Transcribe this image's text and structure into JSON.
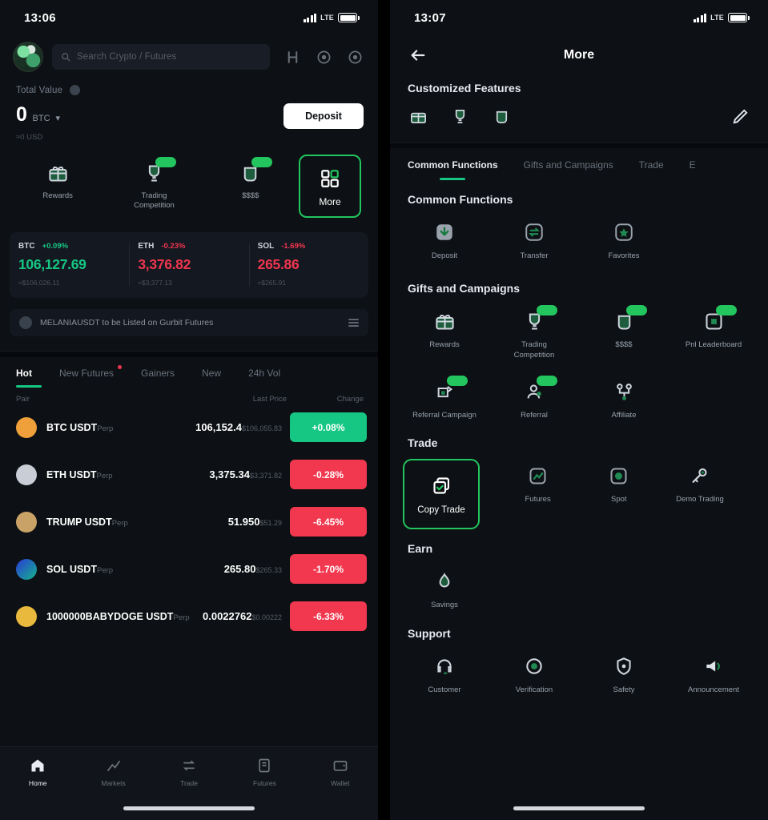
{
  "left": {
    "status": {
      "time": "13:06",
      "network": "LTE"
    },
    "header": {
      "search_placeholder": "Search Crypto / Futures",
      "icons": [
        "menu-icon",
        "support-icon",
        "notification-icon"
      ]
    },
    "balance": {
      "total_value_label": "Total Value",
      "amount": "0",
      "currency": "BTC",
      "approx": "≈0 USD",
      "deposit_label": "Deposit"
    },
    "quick_actions": [
      {
        "label": "Rewards",
        "icon": "gift-icon",
        "badge": false
      },
      {
        "label": "Trading Competition",
        "icon": "trophy-icon",
        "badge": true
      },
      {
        "label": "$$$$",
        "icon": "coin-icon",
        "badge": true
      },
      {
        "label": "More",
        "icon": "grid-icon",
        "badge": false,
        "selected": true
      }
    ],
    "tickers": [
      {
        "symbol": "BTC",
        "change": "+0.09%",
        "price": "106,127.69",
        "volume": "≈$106,026.11",
        "dir": "up"
      },
      {
        "symbol": "ETH",
        "change": "-0.23%",
        "price": "3,376.82",
        "volume": "≈$3,377.13",
        "dir": "down"
      },
      {
        "symbol": "SOL",
        "change": "-1.69%",
        "price": "265.86",
        "volume": "≈$265.91",
        "dir": "down"
      }
    ],
    "announcement": {
      "text": "MELANIAUSDT to be Listed on Gurbit Futures"
    },
    "market": {
      "tabs": [
        {
          "label": "Hot",
          "active": true,
          "dot": false
        },
        {
          "label": "New Futures",
          "active": false,
          "dot": true
        },
        {
          "label": "Gainers",
          "active": false,
          "dot": false
        },
        {
          "label": "New",
          "active": false,
          "dot": false
        },
        {
          "label": "24h Vol",
          "active": false,
          "dot": false
        }
      ],
      "columns": {
        "pair": "Pair",
        "last_price": "Last Price",
        "change": "Change"
      },
      "rows": [
        {
          "symbol": "BTC USDT",
          "type": "Perp",
          "price": "106,152.4",
          "volume": "$106,055.83",
          "change": "+0.08%",
          "dir": "up",
          "color": "#f0a03a"
        },
        {
          "symbol": "ETH USDT",
          "type": "Perp",
          "price": "3,375.34",
          "volume": "$3,371.82",
          "change": "-0.28%",
          "dir": "down",
          "color": "#c8cdd6"
        },
        {
          "symbol": "TRUMP USDT",
          "type": "Perp",
          "price": "51.950",
          "volume": "$51.29",
          "change": "-6.45%",
          "dir": "down",
          "color": "#c9a267"
        },
        {
          "symbol": "SOL USDT",
          "type": "Perp",
          "price": "265.80",
          "volume": "$265.33",
          "change": "-1.70%",
          "dir": "down",
          "color": "#3b5bd6"
        },
        {
          "symbol": "1000000BABYDOGE USDT",
          "type": "Perp",
          "price": "0.0022762",
          "volume": "$0.00222",
          "change": "-6.33%",
          "dir": "down",
          "color": "#e8b93c"
        }
      ]
    },
    "bottom_nav": [
      {
        "label": "Home",
        "icon": "home-icon",
        "active": true
      },
      {
        "label": "Markets",
        "icon": "chart-icon",
        "active": false
      },
      {
        "label": "Trade",
        "icon": "trade-icon",
        "active": false
      },
      {
        "label": "Futures",
        "icon": "futures-icon",
        "active": false
      },
      {
        "label": "Wallet",
        "icon": "wallet-icon",
        "active": false
      }
    ]
  },
  "right": {
    "status": {
      "time": "13:07",
      "network": "LTE"
    },
    "title": "More",
    "back_icon": "back-arrow-icon",
    "customized": {
      "title": "Customized Features",
      "edit_icon": "pencil-icon",
      "icons": [
        "gift-icon",
        "trophy-icon",
        "coin-icon"
      ]
    },
    "tabs": [
      {
        "label": "Common Functions",
        "active": true
      },
      {
        "label": "Gifts and Campaigns",
        "active": false
      },
      {
        "label": "Trade",
        "active": false
      },
      {
        "label": "E",
        "active": false
      }
    ],
    "sections": [
      {
        "title": "Common Functions",
        "items": [
          {
            "label": "Deposit",
            "icon": "deposit-icon",
            "badge": false
          },
          {
            "label": "Transfer",
            "icon": "transfer-icon",
            "badge": false
          },
          {
            "label": "Favorites",
            "icon": "star-icon",
            "badge": false
          }
        ]
      },
      {
        "title": "Gifts and Campaigns",
        "items": [
          {
            "label": "Rewards",
            "icon": "gift-icon",
            "badge": false
          },
          {
            "label": "Trading Competition",
            "icon": "trophy-icon",
            "badge": true
          },
          {
            "label": "$$$$",
            "icon": "coin-icon",
            "badge": true
          },
          {
            "label": "Pnl Leaderboard",
            "icon": "leaderboard-icon",
            "badge": true
          },
          {
            "label": "Referral Campaign",
            "icon": "referral-campaign-icon",
            "badge": true
          },
          {
            "label": "Referral",
            "icon": "referral-icon",
            "badge": true
          },
          {
            "label": "Affiliate",
            "icon": "affiliate-icon",
            "badge": false
          }
        ]
      },
      {
        "title": "Trade",
        "items": [
          {
            "label": "Copy Trade",
            "icon": "copy-trade-icon",
            "selected": true
          },
          {
            "label": "Futures",
            "icon": "futures-icon",
            "badge": false
          },
          {
            "label": "Spot",
            "icon": "spot-icon",
            "badge": false
          },
          {
            "label": "Demo Trading",
            "icon": "demo-trading-icon",
            "badge": false
          }
        ]
      },
      {
        "title": "Earn",
        "items": [
          {
            "label": "Savings",
            "icon": "savings-icon",
            "badge": false
          }
        ]
      },
      {
        "title": "Support",
        "items": [
          {
            "label": "Customer",
            "icon": "headset-icon",
            "badge": false
          },
          {
            "label": "Verification",
            "icon": "verify-icon",
            "badge": false
          },
          {
            "label": "Safety",
            "icon": "shield-icon",
            "badge": false
          },
          {
            "label": "Announcement",
            "icon": "megaphone-icon",
            "badge": false
          }
        ]
      }
    ]
  },
  "colors": {
    "accent_green": "#22c55e",
    "up_green": "#16c784",
    "down_red": "#f0364f",
    "panel_bg": "#0d1014"
  }
}
